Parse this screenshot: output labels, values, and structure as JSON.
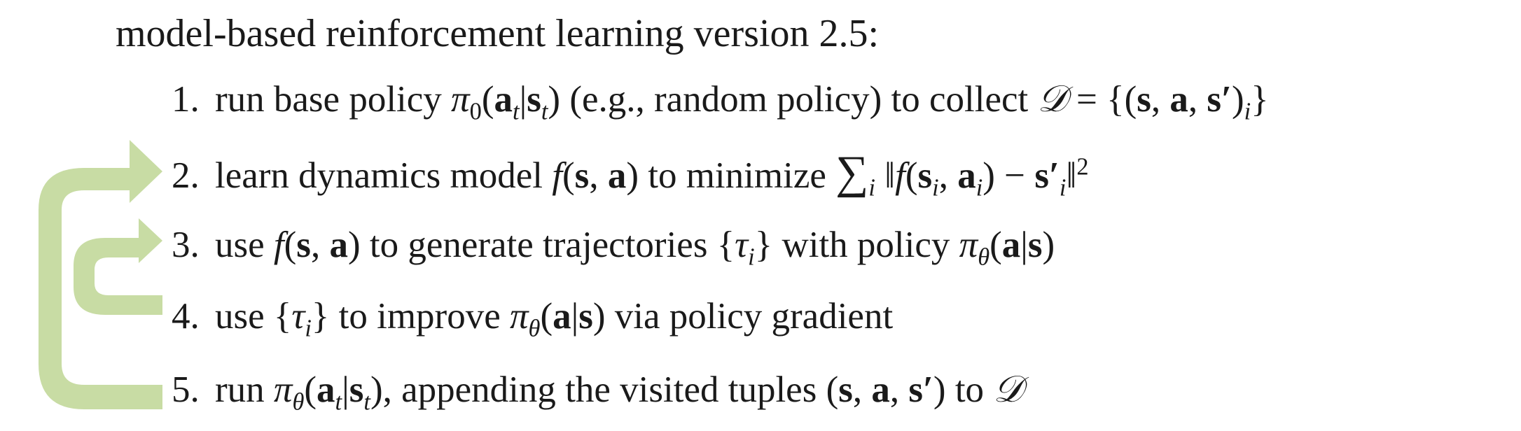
{
  "title": "model-based reinforcement learning version 2.5:",
  "colors": {
    "arrow": "#c8dca4",
    "text": "#1a1a1a",
    "background": "#ffffff"
  },
  "steps": [
    {
      "number": "1.",
      "segments": {
        "a": "run base policy ",
        "b": " (e.g., random policy) to collect "
      },
      "math": {
        "pi": "π",
        "sub0": "0",
        "a": "a",
        "t1": "t",
        "bar": "|",
        "s": "s",
        "t2": "t",
        "D": "𝒟",
        "eq": " = {(",
        "s1": "s",
        "comma1": ", ",
        "a1": "a",
        "comma2": ", ",
        "s2": "s′",
        "close": ")",
        "i": "i",
        "brace": "}"
      }
    },
    {
      "number": "2.",
      "segments": {
        "a": "learn dynamics model ",
        "b": " to minimize "
      },
      "math": {
        "f": "f",
        "open": "(",
        "s": "s",
        "comma": ", ",
        "a": "a",
        "close": ")",
        "sum": "∑",
        "i": "i",
        "norm1": " ‖",
        "f2": "f",
        "open2": "(",
        "si": "s",
        "sub_i1": "i",
        "comma2": ", ",
        "ai": "a",
        "sub_i2": "i",
        "close2": ") − ",
        "sprime": "s′",
        "sub_i3": "i",
        "norm2": "‖",
        "sq": "2"
      }
    },
    {
      "number": "3.",
      "segments": {
        "a": "use ",
        "b": " to generate trajectories ",
        "c": " with policy "
      },
      "math": {
        "f": "f",
        "open": "(",
        "s": "s",
        "comma": ", ",
        "a": "a",
        "close": ")",
        "lbrace": "{",
        "tau": "τ",
        "i": "i",
        "rbrace": "}",
        "pi": "π",
        "theta": "θ",
        "open2": "(",
        "a2": "a",
        "bar": "|",
        "s2": "s",
        "close2": ")"
      }
    },
    {
      "number": "4.",
      "segments": {
        "a": "use ",
        "b": " to improve ",
        "c": " via policy gradient"
      },
      "math": {
        "lbrace": "{",
        "tau": "τ",
        "i": "i",
        "rbrace": "}",
        "pi": "π",
        "theta": "θ",
        "open": "(",
        "a": "a",
        "bar": "|",
        "s": "s",
        "close": ")"
      }
    },
    {
      "number": "5.",
      "segments": {
        "a": "run ",
        "b": ", appending the visited tuples ",
        "c": " to "
      },
      "math": {
        "pi": "π",
        "theta": "θ",
        "open": "(",
        "a": "a",
        "t1": "t",
        "bar": "|",
        "s": "s",
        "t2": "t",
        "close": ")",
        "open2": "(",
        "s2": "s",
        "comma1": ", ",
        "a2": "a",
        "comma2": ", ",
        "sprime": "s′",
        "close2": ")",
        "D": "𝒟"
      }
    }
  ]
}
